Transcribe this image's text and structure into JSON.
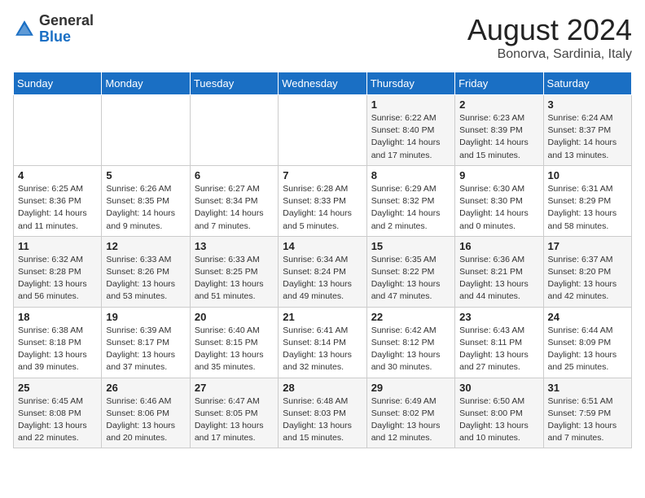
{
  "header": {
    "logo_general": "General",
    "logo_blue": "Blue",
    "month_year": "August 2024",
    "location": "Bonorva, Sardinia, Italy"
  },
  "days_of_week": [
    "Sunday",
    "Monday",
    "Tuesday",
    "Wednesday",
    "Thursday",
    "Friday",
    "Saturday"
  ],
  "weeks": [
    [
      {
        "day": "",
        "detail": ""
      },
      {
        "day": "",
        "detail": ""
      },
      {
        "day": "",
        "detail": ""
      },
      {
        "day": "",
        "detail": ""
      },
      {
        "day": "1",
        "detail": "Sunrise: 6:22 AM\nSunset: 8:40 PM\nDaylight: 14 hours and 17 minutes."
      },
      {
        "day": "2",
        "detail": "Sunrise: 6:23 AM\nSunset: 8:39 PM\nDaylight: 14 hours and 15 minutes."
      },
      {
        "day": "3",
        "detail": "Sunrise: 6:24 AM\nSunset: 8:37 PM\nDaylight: 14 hours and 13 minutes."
      }
    ],
    [
      {
        "day": "4",
        "detail": "Sunrise: 6:25 AM\nSunset: 8:36 PM\nDaylight: 14 hours and 11 minutes."
      },
      {
        "day": "5",
        "detail": "Sunrise: 6:26 AM\nSunset: 8:35 PM\nDaylight: 14 hours and 9 minutes."
      },
      {
        "day": "6",
        "detail": "Sunrise: 6:27 AM\nSunset: 8:34 PM\nDaylight: 14 hours and 7 minutes."
      },
      {
        "day": "7",
        "detail": "Sunrise: 6:28 AM\nSunset: 8:33 PM\nDaylight: 14 hours and 5 minutes."
      },
      {
        "day": "8",
        "detail": "Sunrise: 6:29 AM\nSunset: 8:32 PM\nDaylight: 14 hours and 2 minutes."
      },
      {
        "day": "9",
        "detail": "Sunrise: 6:30 AM\nSunset: 8:30 PM\nDaylight: 14 hours and 0 minutes."
      },
      {
        "day": "10",
        "detail": "Sunrise: 6:31 AM\nSunset: 8:29 PM\nDaylight: 13 hours and 58 minutes."
      }
    ],
    [
      {
        "day": "11",
        "detail": "Sunrise: 6:32 AM\nSunset: 8:28 PM\nDaylight: 13 hours and 56 minutes."
      },
      {
        "day": "12",
        "detail": "Sunrise: 6:33 AM\nSunset: 8:26 PM\nDaylight: 13 hours and 53 minutes."
      },
      {
        "day": "13",
        "detail": "Sunrise: 6:33 AM\nSunset: 8:25 PM\nDaylight: 13 hours and 51 minutes."
      },
      {
        "day": "14",
        "detail": "Sunrise: 6:34 AM\nSunset: 8:24 PM\nDaylight: 13 hours and 49 minutes."
      },
      {
        "day": "15",
        "detail": "Sunrise: 6:35 AM\nSunset: 8:22 PM\nDaylight: 13 hours and 47 minutes."
      },
      {
        "day": "16",
        "detail": "Sunrise: 6:36 AM\nSunset: 8:21 PM\nDaylight: 13 hours and 44 minutes."
      },
      {
        "day": "17",
        "detail": "Sunrise: 6:37 AM\nSunset: 8:20 PM\nDaylight: 13 hours and 42 minutes."
      }
    ],
    [
      {
        "day": "18",
        "detail": "Sunrise: 6:38 AM\nSunset: 8:18 PM\nDaylight: 13 hours and 39 minutes."
      },
      {
        "day": "19",
        "detail": "Sunrise: 6:39 AM\nSunset: 8:17 PM\nDaylight: 13 hours and 37 minutes."
      },
      {
        "day": "20",
        "detail": "Sunrise: 6:40 AM\nSunset: 8:15 PM\nDaylight: 13 hours and 35 minutes."
      },
      {
        "day": "21",
        "detail": "Sunrise: 6:41 AM\nSunset: 8:14 PM\nDaylight: 13 hours and 32 minutes."
      },
      {
        "day": "22",
        "detail": "Sunrise: 6:42 AM\nSunset: 8:12 PM\nDaylight: 13 hours and 30 minutes."
      },
      {
        "day": "23",
        "detail": "Sunrise: 6:43 AM\nSunset: 8:11 PM\nDaylight: 13 hours and 27 minutes."
      },
      {
        "day": "24",
        "detail": "Sunrise: 6:44 AM\nSunset: 8:09 PM\nDaylight: 13 hours and 25 minutes."
      }
    ],
    [
      {
        "day": "25",
        "detail": "Sunrise: 6:45 AM\nSunset: 8:08 PM\nDaylight: 13 hours and 22 minutes."
      },
      {
        "day": "26",
        "detail": "Sunrise: 6:46 AM\nSunset: 8:06 PM\nDaylight: 13 hours and 20 minutes."
      },
      {
        "day": "27",
        "detail": "Sunrise: 6:47 AM\nSunset: 8:05 PM\nDaylight: 13 hours and 17 minutes."
      },
      {
        "day": "28",
        "detail": "Sunrise: 6:48 AM\nSunset: 8:03 PM\nDaylight: 13 hours and 15 minutes."
      },
      {
        "day": "29",
        "detail": "Sunrise: 6:49 AM\nSunset: 8:02 PM\nDaylight: 13 hours and 12 minutes."
      },
      {
        "day": "30",
        "detail": "Sunrise: 6:50 AM\nSunset: 8:00 PM\nDaylight: 13 hours and 10 minutes."
      },
      {
        "day": "31",
        "detail": "Sunrise: 6:51 AM\nSunset: 7:59 PM\nDaylight: 13 hours and 7 minutes."
      }
    ]
  ]
}
